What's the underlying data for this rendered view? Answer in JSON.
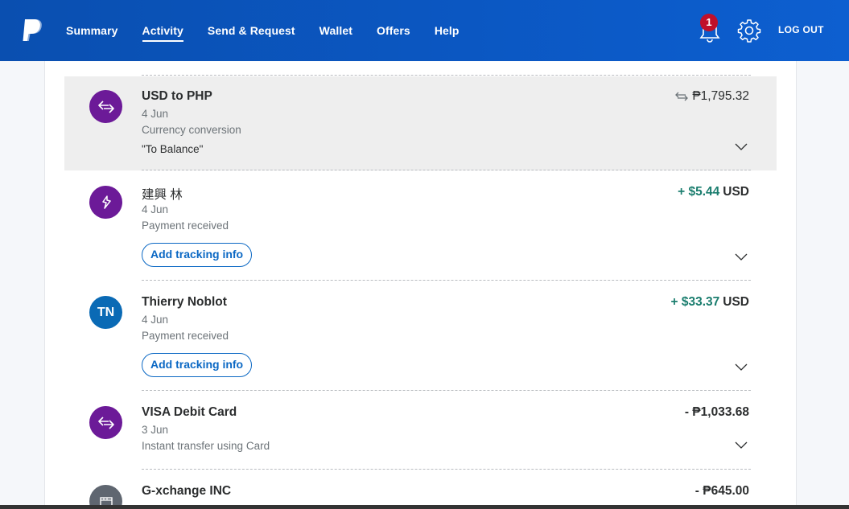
{
  "header": {
    "logo": "paypal-logo",
    "nav": [
      "Summary",
      "Activity",
      "Send & Request",
      "Wallet",
      "Offers",
      "Help"
    ],
    "active_nav": "Activity",
    "notification_count": "1",
    "logout_label": "LOG OUT"
  },
  "transactions": [
    {
      "name": "USD to PHP",
      "date": "4 Jun",
      "description": "Currency conversion",
      "note": "\"To Balance\"",
      "amount": "₱1,795.32",
      "avatar_icon": "exchange-icon",
      "highlighted": true
    },
    {
      "name": "建興 林",
      "date": "4 Jun",
      "description": "Payment received",
      "amount_sign": "+ $5.44",
      "currency": "USD",
      "action": "Add tracking info",
      "avatar_icon": "payment-received-icon"
    },
    {
      "name": "Thierry Noblot",
      "date": "4 Jun",
      "description": "Payment received",
      "amount_sign": "+ $33.37",
      "currency": "USD",
      "action": "Add tracking info",
      "avatar_initials": "TN"
    },
    {
      "name": "VISA Debit Card",
      "date": "3 Jun",
      "description": "Instant transfer using Card",
      "amount": "- ₱1,033.68",
      "avatar_icon": "exchange-icon"
    },
    {
      "name": "G-xchange INC",
      "amount": "- ₱645.00",
      "avatar_icon": "store-icon"
    }
  ],
  "colors": {
    "header_blue": "#0b57c2",
    "purple_avatar": "#6c1a98",
    "blue_avatar": "#0a6ab5",
    "positive_green": "#1a7d6e",
    "link_blue": "#0b68c4",
    "badge_red": "#c0102a"
  }
}
